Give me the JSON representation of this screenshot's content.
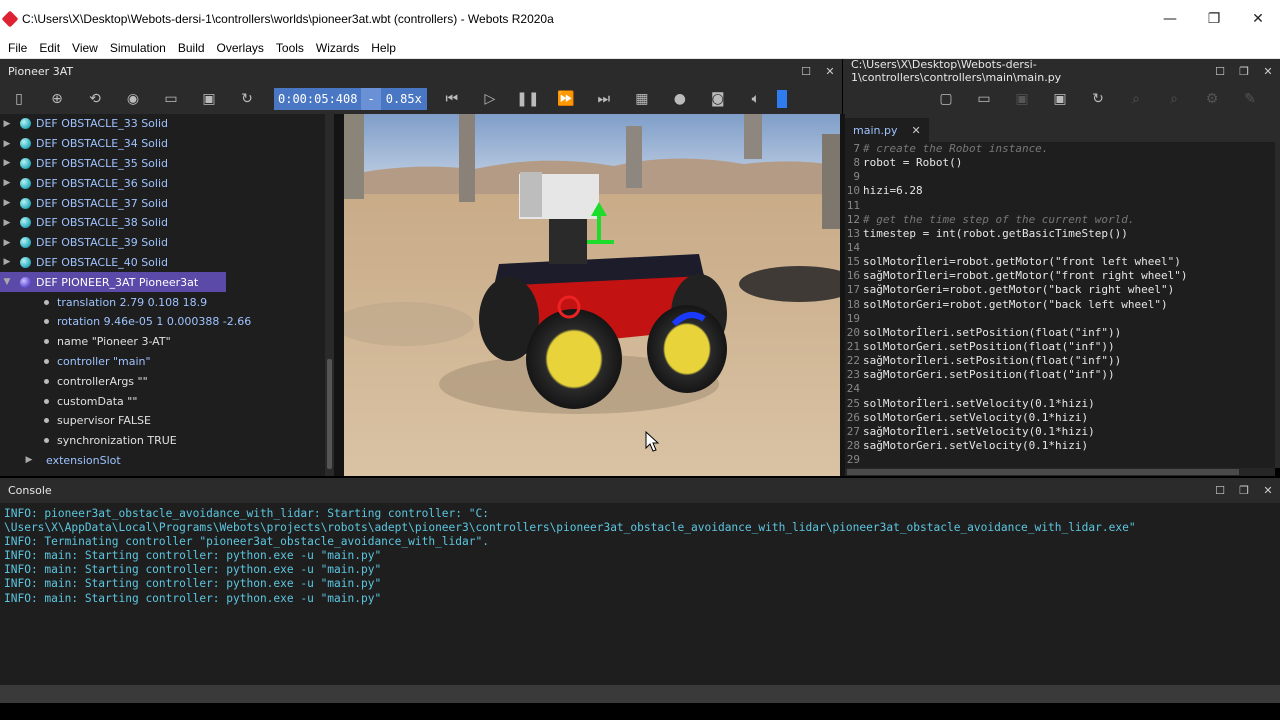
{
  "window": {
    "title": "C:\\Users\\X\\Desktop\\Webots-dersi-1\\controllers\\worlds\\pioneer3at.wbt (controllers) - Webots R2020a",
    "minimize": "—",
    "restore": "❐",
    "close": "✕"
  },
  "menu": [
    "File",
    "Edit",
    "View",
    "Simulation",
    "Build",
    "Overlays",
    "Tools",
    "Wizards",
    "Help"
  ],
  "left_dock": {
    "title": "Pioneer 3AT"
  },
  "sim_toolbar": {
    "time": "0:00:05:408",
    "separator": "-",
    "speed": "0.85x"
  },
  "scene_tree": {
    "obstacles": [
      "DEF OBSTACLE_33 Solid",
      "DEF OBSTACLE_34 Solid",
      "DEF OBSTACLE_35 Solid",
      "DEF OBSTACLE_36 Solid",
      "DEF OBSTACLE_37 Solid",
      "DEF OBSTACLE_38 Solid",
      "DEF OBSTACLE_39 Solid",
      "DEF OBSTACLE_40 Solid"
    ],
    "robot": "DEF PIONEER_3AT Pioneer3at",
    "fields": [
      "translation 2.79 0.108 18.9",
      "rotation 9.46e-05 1 0.000388 -2.66",
      "name \"Pioneer 3-AT\"",
      "controller \"main\"",
      "controllerArgs \"\"",
      "customData \"\"",
      "supervisor FALSE",
      "synchronization TRUE"
    ],
    "extension": "extensionSlot"
  },
  "editor": {
    "title": "C:\\Users\\X\\Desktop\\Webots-dersi-1\\controllers\\controllers\\main\\main.py",
    "tab": "main.py",
    "lines": [
      {
        "n": "7",
        "t": "# create the Robot instance."
      },
      {
        "n": "8",
        "t": "robot = Robot()"
      },
      {
        "n": "9",
        "t": ""
      },
      {
        "n": "10",
        "t": "hizi=6.28"
      },
      {
        "n": "11",
        "t": ""
      },
      {
        "n": "12",
        "t": "# get the time step of the current world."
      },
      {
        "n": "13",
        "t": "timestep = int(robot.getBasicTimeStep())"
      },
      {
        "n": "14",
        "t": ""
      },
      {
        "n": "15",
        "t": "solMotorİleri=robot.getMotor(\"front left wheel\")"
      },
      {
        "n": "16",
        "t": "sağMotorİleri=robot.getMotor(\"front right wheel\")"
      },
      {
        "n": "17",
        "t": "sağMotorGeri=robot.getMotor(\"back right wheel\")"
      },
      {
        "n": "18",
        "t": "solMotorGeri=robot.getMotor(\"back left wheel\")"
      },
      {
        "n": "19",
        "t": ""
      },
      {
        "n": "20",
        "t": "solMotorİleri.setPosition(float(\"inf\"))"
      },
      {
        "n": "21",
        "t": "solMotorGeri.setPosition(float(\"inf\"))"
      },
      {
        "n": "22",
        "t": "sağMotorİleri.setPosition(float(\"inf\"))"
      },
      {
        "n": "23",
        "t": "sağMotorGeri.setPosition(float(\"inf\"))"
      },
      {
        "n": "24",
        "t": ""
      },
      {
        "n": "25",
        "t": "solMotorİleri.setVelocity(0.1*hizi)"
      },
      {
        "n": "26",
        "t": "solMotorGeri.setVelocity(0.1*hizi)"
      },
      {
        "n": "27",
        "t": "sağMotorİleri.setVelocity(0.1*hizi)"
      },
      {
        "n": "28",
        "t": "sağMotorGeri.setVelocity(0.1*hizi)"
      },
      {
        "n": "29",
        "t": ""
      }
    ]
  },
  "console": {
    "title": "Console",
    "lines": [
      "INFO: pioneer3at_obstacle_avoidance_with_lidar: Starting controller: \"C:",
      "\\Users\\X\\AppData\\Local\\Programs\\Webots\\projects\\robots\\adept\\pioneer3\\controllers\\pioneer3at_obstacle_avoidance_with_lidar\\pioneer3at_obstacle_avoidance_with_lidar.exe\"",
      "INFO: Terminating controller \"pioneer3at_obstacle_avoidance_with_lidar\".",
      "INFO: main: Starting controller: python.exe -u \"main.py\"",
      "INFO: main: Starting controller: python.exe -u \"main.py\"",
      "INFO: main: Starting controller: python.exe -u \"main.py\"",
      "INFO: main: Starting controller: python.exe -u \"main.py\""
    ]
  },
  "colors": {
    "selection": "#5b4aa8",
    "time_box": "#4a77c4",
    "console_text": "#5cc6e0",
    "highlight": "#d400d4"
  }
}
